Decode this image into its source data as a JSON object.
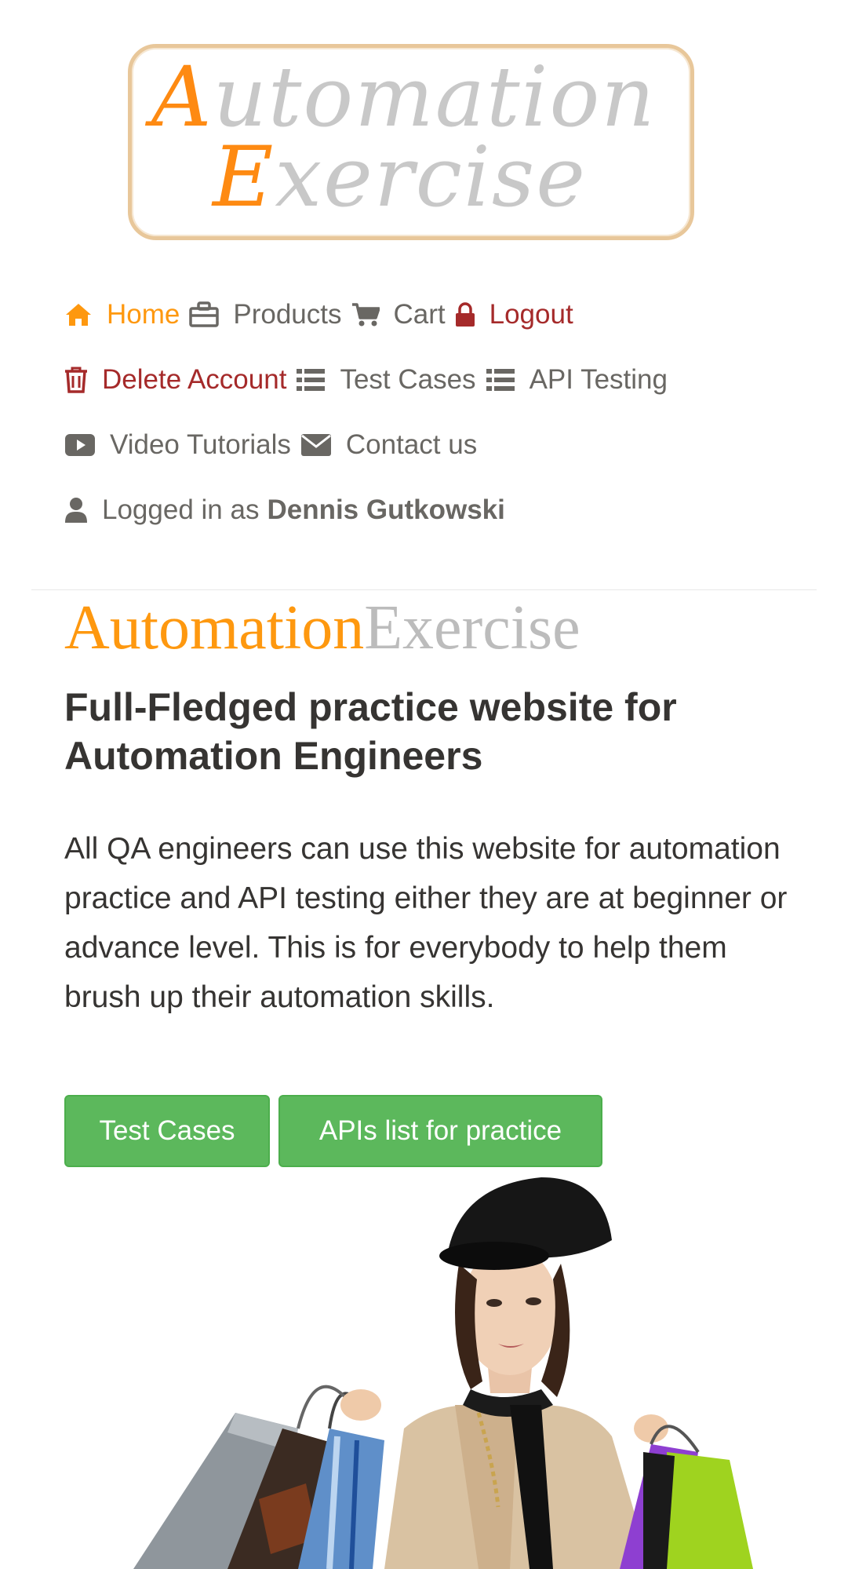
{
  "logo": {
    "line1_first": "A",
    "line1_rest": "utomation",
    "line2_first": "E",
    "line2_rest": "xercise",
    "colors": {
      "accent": "#fe8a12",
      "muted": "#c8c8c8",
      "frame": "#e8c79a"
    }
  },
  "nav": {
    "items": [
      {
        "label": "Home",
        "icon": "home-icon",
        "state": "active"
      },
      {
        "label": "Products",
        "icon": "briefcase-icon"
      },
      {
        "label": "Cart",
        "icon": "cart-icon"
      },
      {
        "label": "Logout",
        "icon": "lock-icon",
        "state": "danger"
      },
      {
        "label": "Delete Account",
        "icon": "trash-icon",
        "state": "danger"
      },
      {
        "label": "Test Cases",
        "icon": "list-icon"
      },
      {
        "label": "API Testing",
        "icon": "list-icon"
      },
      {
        "label": "Video Tutorials",
        "icon": "youtube-play-icon"
      },
      {
        "label": "Contact us",
        "icon": "envelope-icon"
      }
    ],
    "logged_in": {
      "icon": "user-icon",
      "label": "Logged in as",
      "name": "Dennis Gutkowski"
    }
  },
  "hero": {
    "brand_part1": "Automation",
    "brand_part2": "Exercise",
    "headline": "Full-Fledged practice website for Automation Engineers",
    "description": "All QA engineers can use this website for automation practice and API testing either they are at beginner or advance level. This is for everybody to help them brush up their automation skills.",
    "buttons": {
      "test_cases": "Test Cases",
      "apis_list": "APIs list for practice"
    }
  },
  "colors": {
    "brand_orange": "#fe980f",
    "nav_text": "#696763",
    "danger": "#a52a2a",
    "button_green": "#5cb85c",
    "heading": "#363432"
  }
}
